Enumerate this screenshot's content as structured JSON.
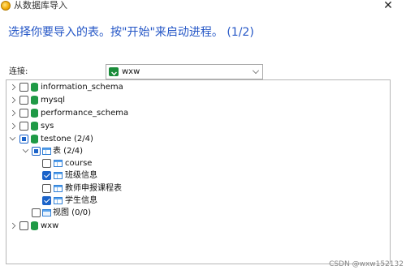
{
  "window": {
    "title": "从数据库导入",
    "close": "✕"
  },
  "heading": "选择你要导入的表。按\"开始\"来启动进程。 (1/2)",
  "connection": {
    "label": "连接:",
    "value": "wxw"
  },
  "tree": {
    "databases": [
      {
        "name": "information_schema",
        "expanded": false,
        "state": "unchecked"
      },
      {
        "name": "mysql",
        "expanded": false,
        "state": "unchecked"
      },
      {
        "name": "performance_schema",
        "expanded": false,
        "state": "unchecked"
      },
      {
        "name": "sys",
        "expanded": false,
        "state": "unchecked"
      },
      {
        "name": "testone (2/4)",
        "expanded": true,
        "state": "partial"
      },
      {
        "name": "wxw",
        "expanded": false,
        "state": "unchecked"
      }
    ],
    "tables_group": {
      "name": "表 (2/4)",
      "expanded": true,
      "state": "partial"
    },
    "tables": [
      {
        "name": "course",
        "state": "unchecked"
      },
      {
        "name": "班级信息",
        "state": "checked"
      },
      {
        "name": "教师申报课程表",
        "state": "unchecked"
      },
      {
        "name": "学生信息",
        "state": "checked"
      }
    ],
    "views_group": {
      "name": "视图 (0/0)",
      "state": "unchecked"
    }
  },
  "watermark": "CSDN @wxw152132",
  "icons": {
    "app": "app-icon",
    "database": "database-icon",
    "table": "table-icon",
    "view": "view-icon",
    "connection": "connection-icon"
  },
  "colors": {
    "heading": "#2456c6",
    "database": "#1f9a46",
    "check": "#1b63c9"
  }
}
